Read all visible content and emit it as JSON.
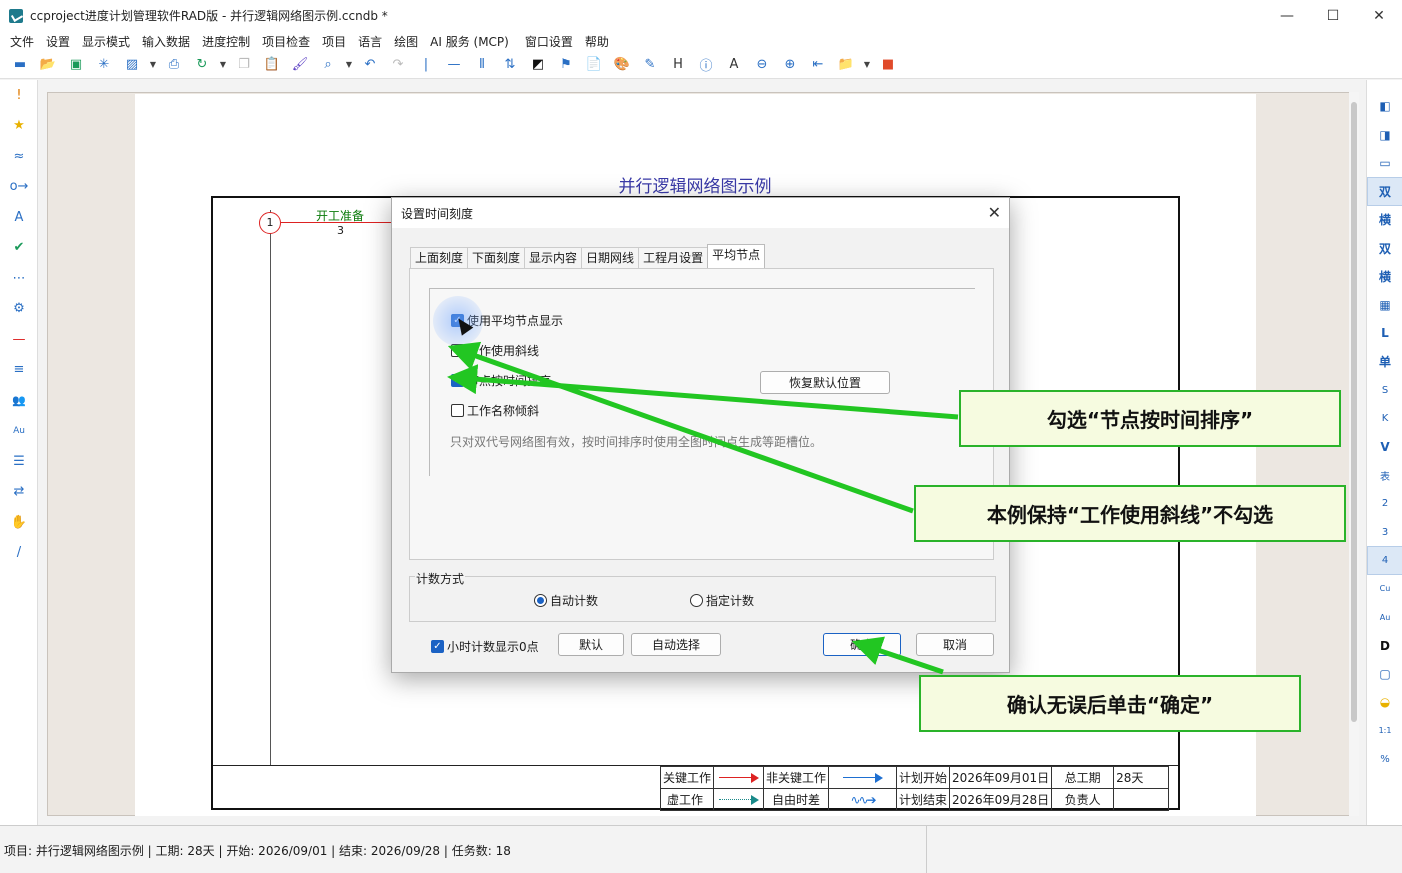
{
  "window": {
    "title": "ccproject进度计划管理软件RAD版 - 并行逻辑网络图示例.ccndb *",
    "min": "—",
    "max": "☐",
    "close": "✕"
  },
  "menu": [
    "文件",
    "设置",
    "显示模式",
    "输入数据",
    "进度控制",
    "项目检查",
    "项目",
    "语言",
    "绘图",
    "AI 服务 (MCP)",
    "窗口设置",
    "帮助"
  ],
  "toolbar_icons": [
    "save-icon",
    "open-icon",
    "save-as-icon",
    "snowflake-icon",
    "export-icon",
    "dropdown-icon",
    "print-icon",
    "refresh-icon",
    "dropdown-icon",
    "copy-icon",
    "paste-icon",
    "format-brush-icon",
    "search-icon",
    "dropdown-icon",
    "undo-icon",
    "redo-icon",
    "separator-icon",
    "line-icon",
    "column-icon",
    "sort-icon",
    "contrast-icon",
    "flag-icon",
    "doc-icon",
    "palette-icon",
    "edit-icon",
    "heading-icon",
    "info-icon",
    "text-icon",
    "zoom-out-icon",
    "zoom-in-icon",
    "back-icon",
    "folder-icon",
    "dropdown-icon",
    "suitcase-icon"
  ],
  "toolbar_glyphs": {
    "heading": "H",
    "info": "ⓘ",
    "text": "A"
  },
  "left_icons": [
    "!",
    "★",
    "≈",
    "o→",
    "A",
    "✔",
    "⋯",
    "⚙",
    "—",
    "≡",
    "👥",
    "Au",
    "☰",
    "⇄",
    "✋",
    "/"
  ],
  "right_icons": [
    "◧",
    "◨",
    "▭",
    "双",
    "横",
    "双",
    "横",
    "▦",
    "L",
    "单",
    "S",
    "K",
    "V",
    "表",
    "2",
    "3",
    "4",
    "Cu",
    "Au",
    "D",
    "▢",
    "◒",
    "1:1",
    "%"
  ],
  "diagram": {
    "title": "并行逻辑网络图示例",
    "node1": "1",
    "task_name": "开工准备",
    "task_dur": "3"
  },
  "legend": {
    "critical": "关键工作",
    "noncritical": "非关键工作",
    "plan_start_label": "计划开始",
    "plan_start": "2026年09月01日",
    "total_dur_label": "总工期",
    "total_dur": "28天",
    "dummy": "虚工作",
    "float": "自由时差",
    "plan_end_label": "计划结束",
    "plan_end": "2026年09月28日",
    "owner_label": "负责人",
    "owner": ""
  },
  "dialog": {
    "title": "设置时间刻度",
    "close": "✕",
    "tabs": [
      "上面刻度",
      "下面刻度",
      "显示内容",
      "日期网线",
      "工程月设置",
      "平均节点"
    ],
    "opt_avg_node": "使用平均节点显示",
    "opt_slash": "工作使用斜线",
    "opt_sort": "节点按时间排序",
    "opt_tilt": "工作名称倾斜",
    "restore_btn": "恢复默认位置",
    "hint": "只对双代号网络图有效，按时间排序时使用全图时间点生成等距槽位。",
    "count_label": "计数方式",
    "radio_auto": "自动计数",
    "radio_manual": "指定计数",
    "hour_zero": "小时计数显示0点",
    "btn_default": "默认",
    "btn_autoselect": "自动选择",
    "btn_ok": "确定",
    "btn_cancel": "取消"
  },
  "callouts": {
    "sort": "勾选“节点按时间排序”",
    "slash": "本例保持“工作使用斜线”不勾选",
    "ok": "确认无误后单击“确定”"
  },
  "status": "项目: 并行逻辑网络图示例 | 工期: 28天 | 开始: 2026/09/01 | 结束: 2026/09/28 | 任务数: 18"
}
